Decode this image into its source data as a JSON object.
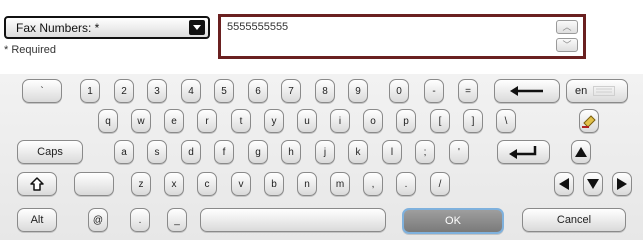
{
  "field": {
    "selector_label": "Fax Numbers: *",
    "required_note": "* Required",
    "input_value": "5555555555"
  },
  "keyboard": {
    "row1": [
      "`",
      "1",
      "2",
      "3",
      "4",
      "5",
      "6",
      "7",
      "8",
      "9",
      "0",
      "-",
      "="
    ],
    "row2": [
      "q",
      "w",
      "e",
      "r",
      "t",
      "y",
      "u",
      "i",
      "o",
      "p",
      "[",
      "]",
      "\\"
    ],
    "row3": [
      "a",
      "s",
      "d",
      "f",
      "g",
      "h",
      "j",
      "k",
      "l",
      ";",
      "'"
    ],
    "row4": [
      "z",
      "x",
      "c",
      "v",
      "b",
      "n",
      "m",
      ",",
      ".",
      "/"
    ],
    "caps_label": "Caps",
    "alt_label": "Alt",
    "at_label": "@",
    "dot_label": ".",
    "underscore_label": "_",
    "lang_label": "en",
    "ok_label": "OK",
    "cancel_label": "Cancel"
  }
}
